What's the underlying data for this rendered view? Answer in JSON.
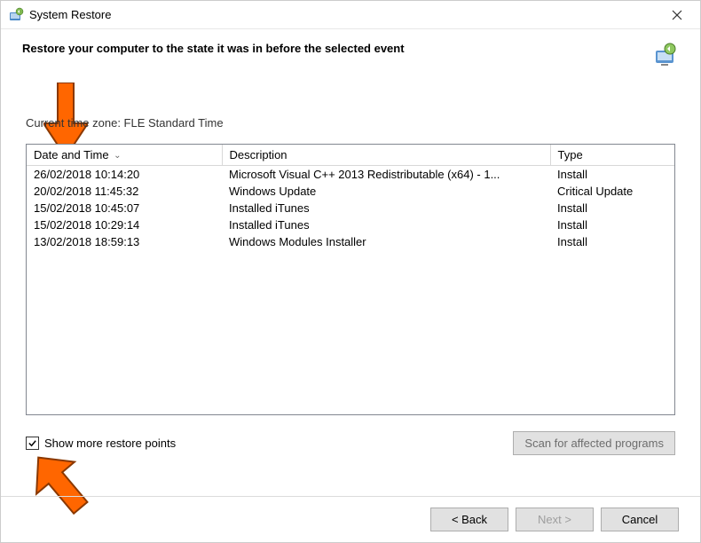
{
  "window": {
    "title": "System Restore"
  },
  "header": {
    "subtitle": "Restore your computer to the state it was in before the selected event"
  },
  "timezone_label": "Current time zone: FLE Standard Time",
  "columns": {
    "date": "Date and Time",
    "desc": "Description",
    "type": "Type"
  },
  "rows": [
    {
      "date": "26/02/2018 10:14:20",
      "desc": "Microsoft Visual C++ 2013 Redistributable (x64) - 1...",
      "type": "Install"
    },
    {
      "date": "20/02/2018 11:45:32",
      "desc": "Windows Update",
      "type": "Critical Update"
    },
    {
      "date": "15/02/2018 10:45:07",
      "desc": "Installed iTunes",
      "type": "Install"
    },
    {
      "date": "15/02/2018 10:29:14",
      "desc": "Installed iTunes",
      "type": "Install"
    },
    {
      "date": "13/02/2018 18:59:13",
      "desc": "Windows Modules Installer",
      "type": "Install"
    }
  ],
  "checkbox": {
    "label": "Show more restore points",
    "checked": true
  },
  "buttons": {
    "scan": "Scan for affected programs",
    "back": "< Back",
    "next": "Next >",
    "cancel": "Cancel"
  }
}
